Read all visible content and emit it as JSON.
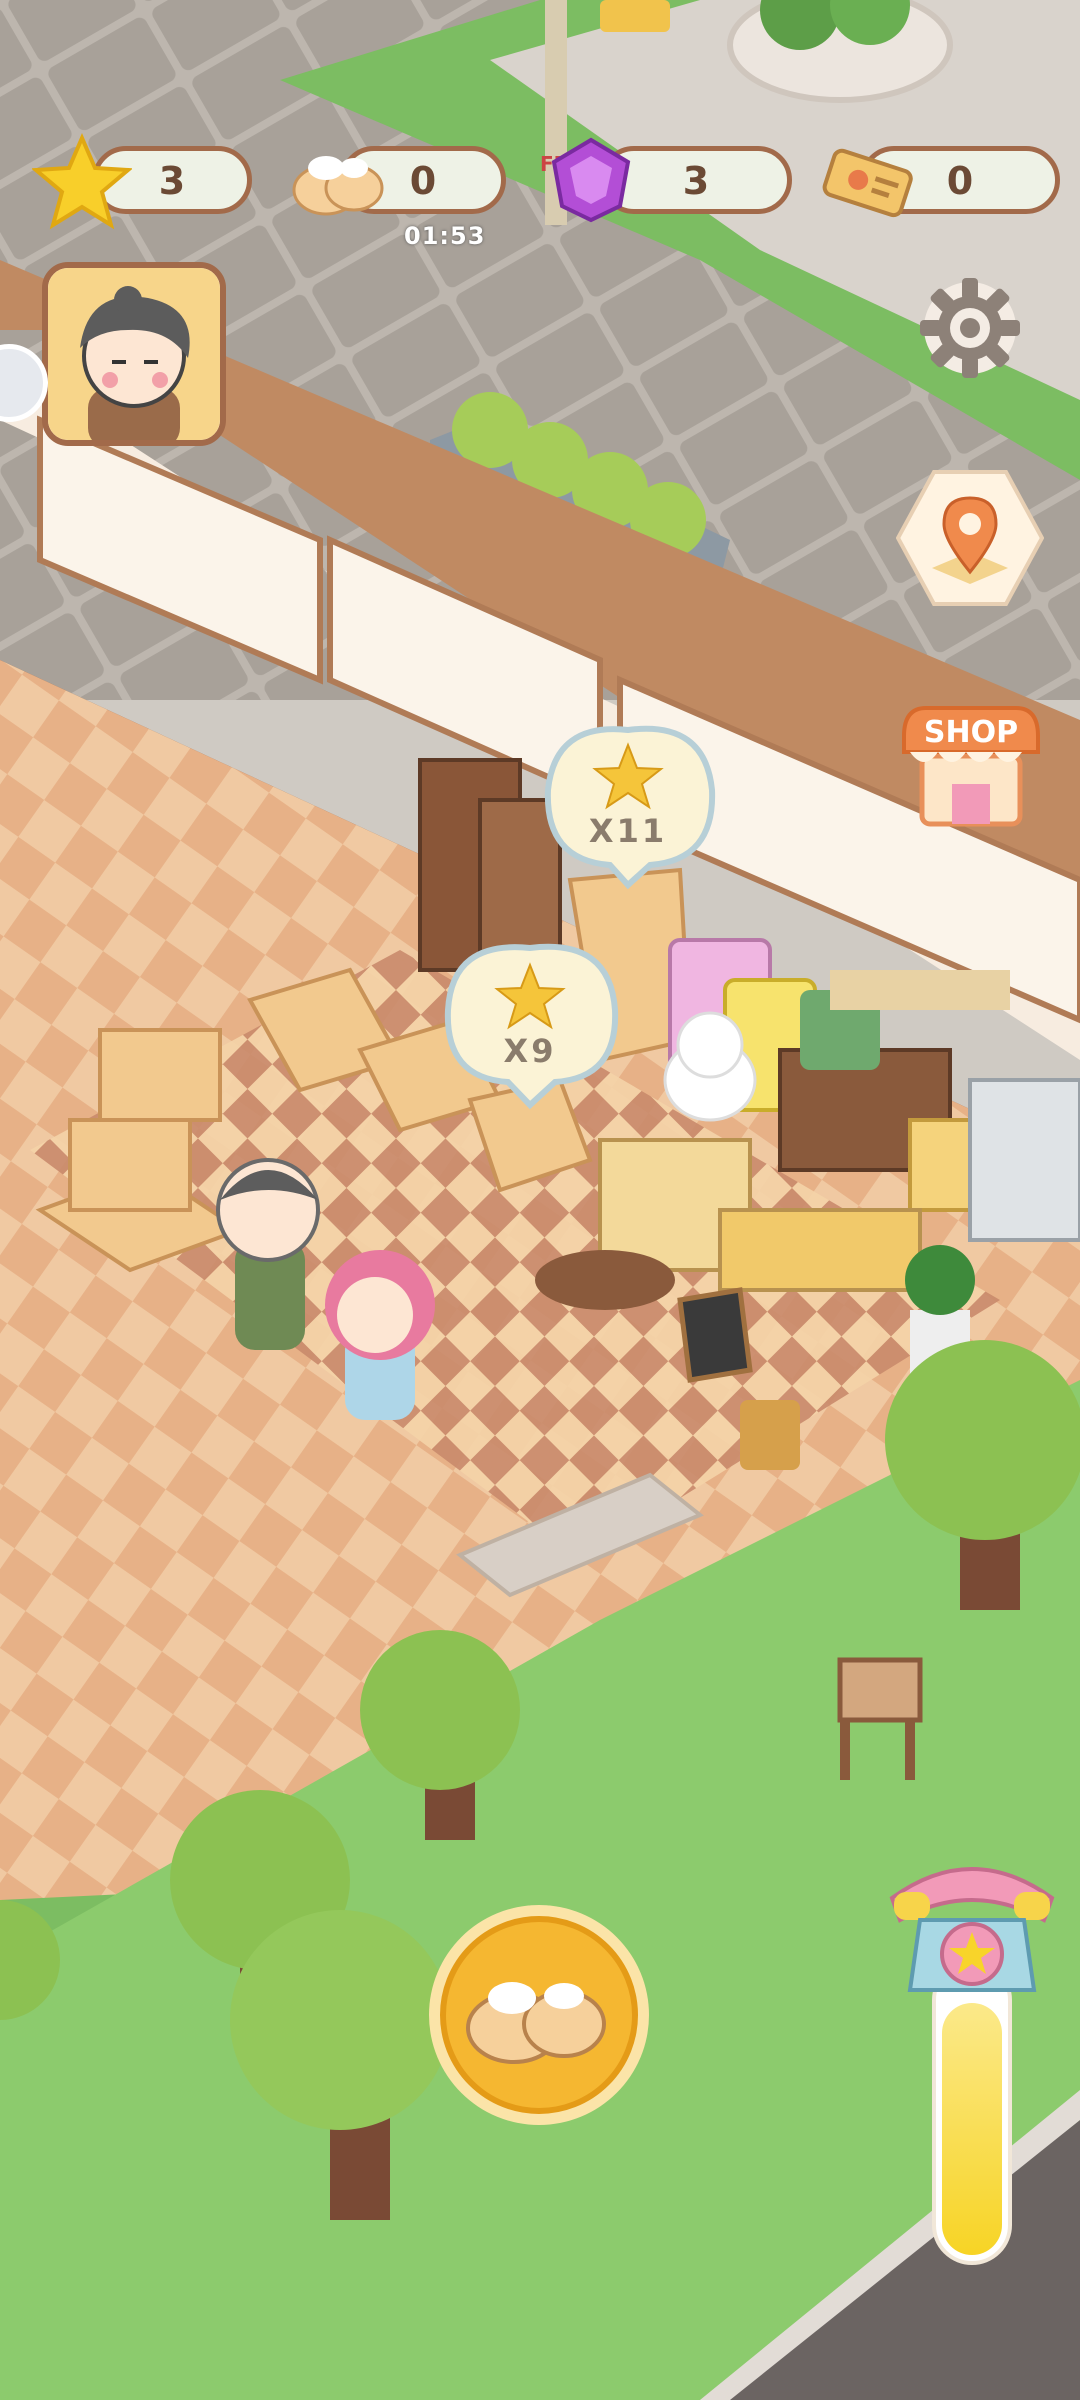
{
  "hud": {
    "stars": "3",
    "buns": "0",
    "bun_timer": "01:53",
    "gems": "3",
    "tickets": "0",
    "fps_label": "FPS:27"
  },
  "bubbles": [
    {
      "label": "X11"
    },
    {
      "label": "X9"
    }
  ],
  "shop_button": {
    "label": "SHOP"
  },
  "icons": {
    "star": "star-icon",
    "bun": "bun-icon",
    "gem": "gem-icon",
    "ticket": "ticket-icon",
    "settings": "gear-icon",
    "map": "location-pin-icon",
    "shop": "shop-icon",
    "phone": "telephone-icon"
  },
  "colors": {
    "accent": "#f5b731",
    "brown": "#a26a4a",
    "grass": "#7cbd62",
    "floor": "#e9b98f"
  },
  "energy_fill": 0.9
}
